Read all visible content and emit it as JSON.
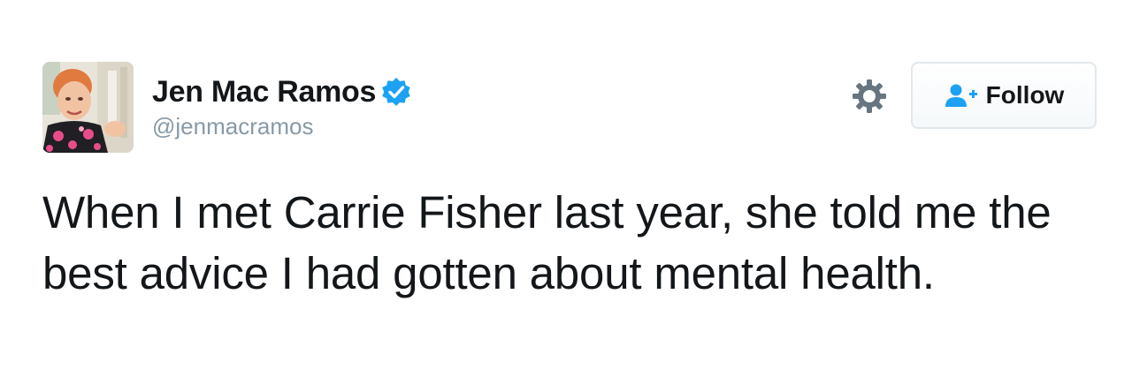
{
  "author": {
    "display_name": "Jen Mac Ramos",
    "handle": "@jenmacramos",
    "verified": true,
    "verified_icon": "verified-badge-icon",
    "avatar_icon": "profile-photo"
  },
  "actions": {
    "settings_icon": "gear-icon",
    "follow_icon": "add-user-icon",
    "follow_label": "Follow"
  },
  "tweet": {
    "text": "When I met Carrie Fisher last year, she told me the best advice I had gotten about mental health."
  },
  "colors": {
    "text": "#14171a",
    "secondary_text": "#8899a6",
    "verified_blue": "#1da1f2",
    "follow_icon_blue": "#1da1f2",
    "button_border": "#e1e8ed",
    "gear_gray": "#66757f"
  }
}
